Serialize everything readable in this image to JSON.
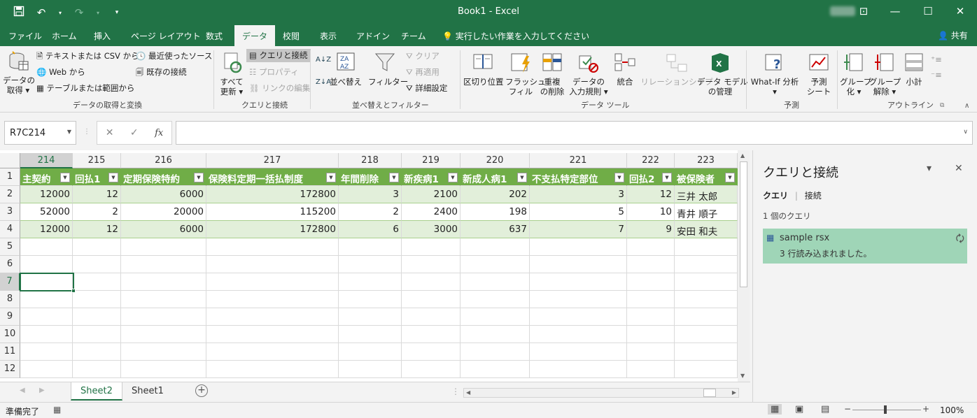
{
  "titlebar": {
    "title": "Book1  -  Excel",
    "qat_icons": [
      "save-icon",
      "undo-icon",
      "redo-icon",
      "customize-icon"
    ],
    "controls": [
      "ribbon-display-icon",
      "minimize-icon",
      "maximize-icon",
      "close-icon"
    ]
  },
  "tabs": [
    "ファイル",
    "ホーム",
    "挿入",
    "ページ レイアウト",
    "数式",
    "データ",
    "校閲",
    "表示",
    "アドイン",
    "チーム"
  ],
  "active_tab": "データ",
  "tell_me": "実行したい作業を入力してください",
  "share": "共有",
  "ribbon": {
    "get_data": "データの\n取得 ▾",
    "from_text": "テキストまたは CSV から",
    "from_web": "Web から",
    "from_table": "テーブルまたは範囲から",
    "recent_sources": "最近使ったソース",
    "existing_connections": "既存の接続",
    "group1": "データの取得と変換",
    "refresh_all": "すべて\n更新 ▾",
    "queries_connections": "クエリと接続",
    "properties": "プロパティ",
    "edit_links": "リンクの編集",
    "group2": "クエリと接続",
    "sort_az": "A↓Z",
    "sort_za": "Z↓A",
    "sort": "並べ替え",
    "filter": "フィルター",
    "clear": "クリア",
    "reapply": "再適用",
    "advanced": "詳細設定",
    "group3": "並べ替えとフィルター",
    "text_to_columns": "区切り位置",
    "flash_fill": "フラッシュ\nフィル",
    "remove_duplicates": "重複\nの削除",
    "data_validation": "データの\n入力規則 ▾",
    "consolidate": "統合",
    "relationships": "リレーションシップ",
    "data_model": "データ モデル\nの管理",
    "group4": "データ ツール",
    "what_if": "What-If 分析\n▾",
    "forecast": "予測\nシート",
    "group5": "予測",
    "group_btn": "グループ\n化 ▾",
    "ungroup": "グループ\n解除 ▾",
    "subtotal": "小計",
    "group6": "アウトライン"
  },
  "name_box": "R7C214",
  "formula": "",
  "columns": [
    "214",
    "215",
    "216",
    "217",
    "218",
    "219",
    "220",
    "221",
    "222",
    "223"
  ],
  "rows": [
    "1",
    "2",
    "3",
    "4",
    "5",
    "6",
    "7",
    "8",
    "9",
    "10",
    "11",
    "12"
  ],
  "table_headers": [
    "主契約",
    "回払1",
    "定期保険特約",
    "保険料定期一括払制度",
    "年間削除",
    "新疾病1",
    "新成人病1",
    "不支払特定部位",
    "回払2",
    "被保険者"
  ],
  "table_rows": [
    [
      "12000",
      "12",
      "6000",
      "172800",
      "3",
      "2100",
      "202",
      "3",
      "12",
      "三井 太郎"
    ],
    [
      "52000",
      "2",
      "20000",
      "115200",
      "2",
      "2400",
      "198",
      "5",
      "10",
      "青井 順子"
    ],
    [
      "12000",
      "12",
      "6000",
      "172800",
      "6",
      "3000",
      "637",
      "7",
      "9",
      "安田 和夫"
    ]
  ],
  "sheets": [
    "Sheet2",
    "Sheet1"
  ],
  "active_sheet": "Sheet2",
  "pane": {
    "title": "クエリと接続",
    "tab_queries": "クエリ",
    "tab_connections": "接続",
    "count": "1 個のクエリ",
    "query_name": "sample rsx",
    "query_status": "3 行読み込まれました。"
  },
  "status": {
    "ready": "準備完了",
    "zoom": "100%"
  },
  "colors": {
    "accent": "#217346",
    "table_header": "#70ad47",
    "band": "#e2efda",
    "query_card": "#9fd5b7"
  }
}
